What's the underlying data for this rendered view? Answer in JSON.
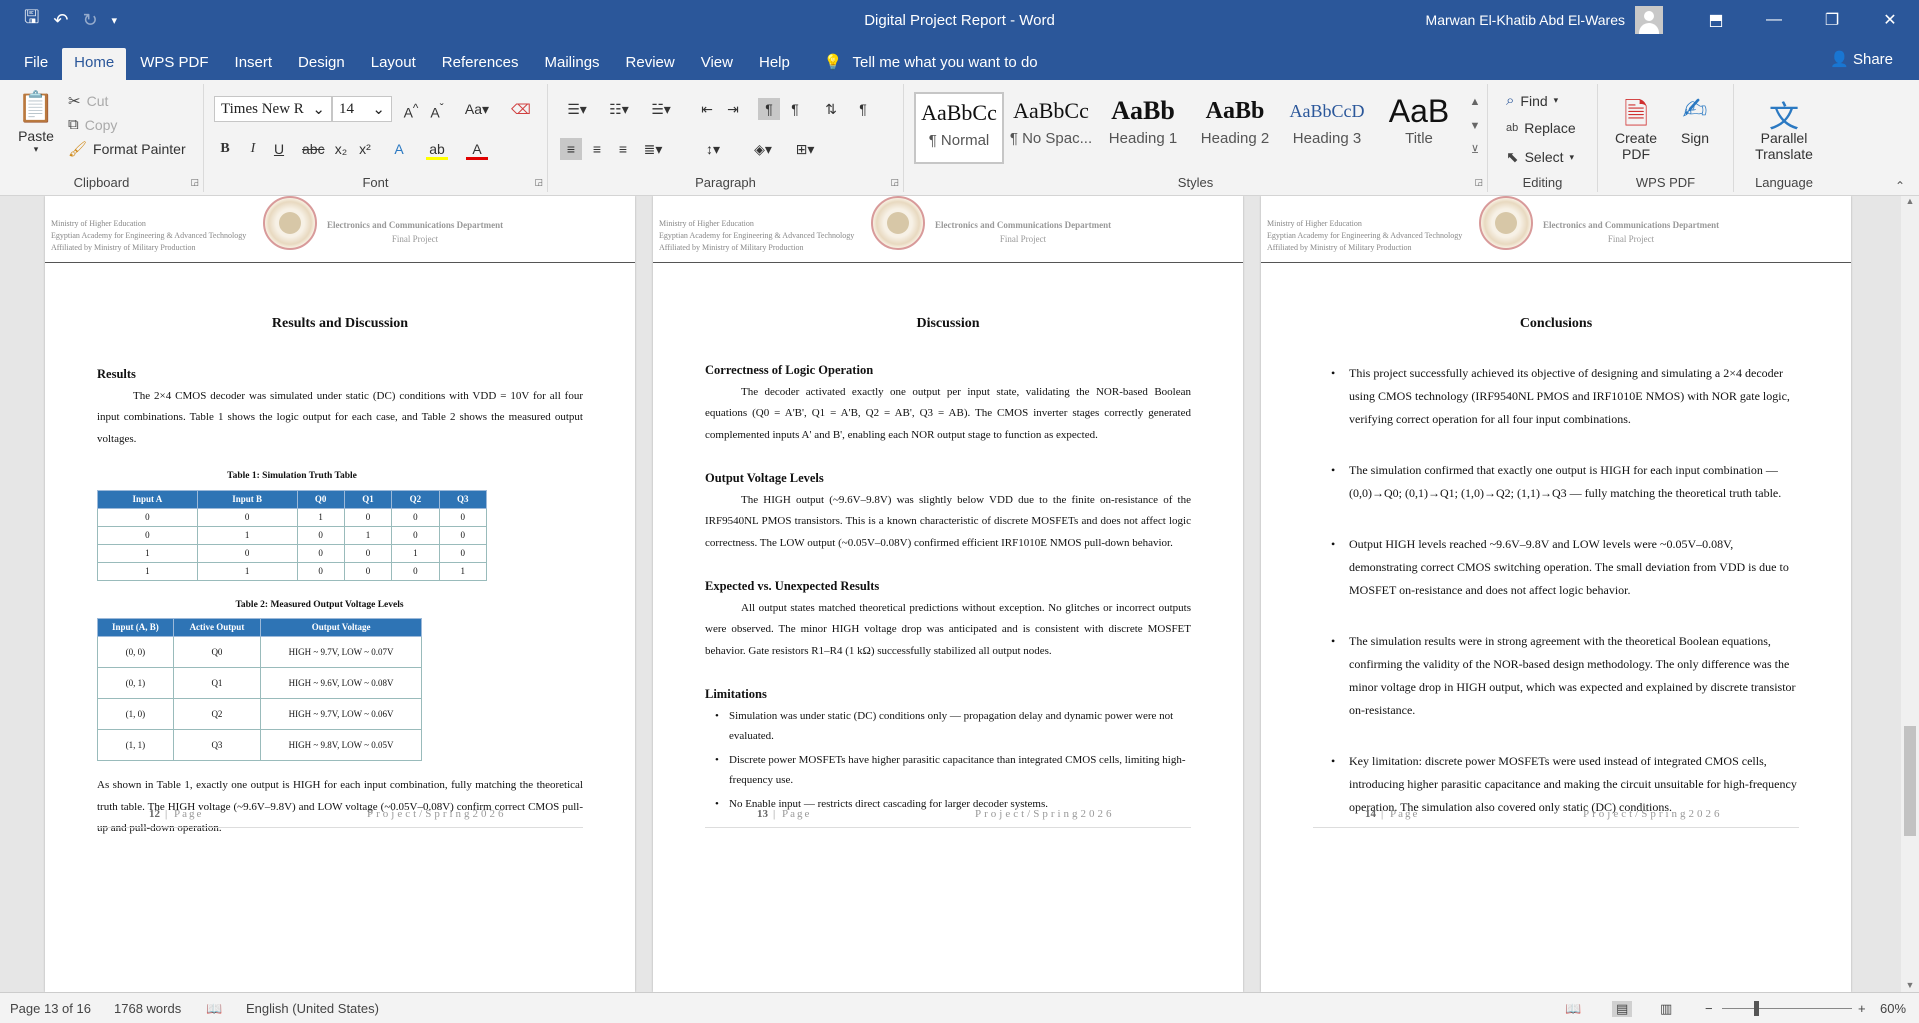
{
  "window": {
    "title": "Digital Project Report  -  Word",
    "user": "Marwan El-Khatib Abd El-Wares"
  },
  "menu": {
    "tabs": [
      "File",
      "Home",
      "WPS PDF",
      "Insert",
      "Design",
      "Layout",
      "References",
      "Mailings",
      "Review",
      "View",
      "Help"
    ],
    "tellme": "Tell me what you want to do",
    "share": "Share"
  },
  "ribbon": {
    "clipboard": {
      "label": "Clipboard",
      "paste": "Paste",
      "cut": "Cut",
      "copy": "Copy",
      "format_painter": "Format Painter"
    },
    "font": {
      "label": "Font",
      "name": "Times New R",
      "size": "14"
    },
    "paragraph": {
      "label": "Paragraph"
    },
    "styles": {
      "label": "Styles",
      "items": [
        {
          "preview": "AaBbCc",
          "name": "¶ Normal"
        },
        {
          "preview": "AaBbCc",
          "name": "¶ No Spac..."
        },
        {
          "preview": "AaBb",
          "name": "Heading 1"
        },
        {
          "preview": "AaBb",
          "name": "Heading 2"
        },
        {
          "preview": "AaBbCcD",
          "name": "Heading 3"
        },
        {
          "preview": "AaB",
          "name": "Title"
        }
      ]
    },
    "editing": {
      "label": "Editing",
      "find": "Find",
      "replace": "Replace",
      "select": "Select"
    },
    "wps": {
      "label": "WPS PDF",
      "create": "Create PDF",
      "sign": "Sign"
    },
    "language": {
      "label": "Language",
      "translate": "Parallel Translate"
    }
  },
  "header": {
    "left1": "Ministry of Higher Education",
    "left2": "Egyptian Academy for Engineering & Advanced Technology",
    "left3": "Affiliated by Ministry of Military Production",
    "dept": "Electronics and Communications Department",
    "final": "Final Project"
  },
  "footer": {
    "page_word": "| Page",
    "project": "Project/Spring2026"
  },
  "page12": {
    "number": "12",
    "title": "Results and Discussion",
    "results_heading": "Results",
    "results_text": "The 2×4 CMOS decoder was simulated under static (DC) conditions with VDD = 10V for all four input combinations. Table 1 shows the logic output for each case, and Table 2 shows the measured output voltages.",
    "table1": {
      "caption": "Table 1: Simulation Truth Table",
      "headers": [
        "Input A",
        "Input B",
        "Q0",
        "Q1",
        "Q2",
        "Q3"
      ],
      "rows": [
        [
          "0",
          "0",
          "1",
          "0",
          "0",
          "0"
        ],
        [
          "0",
          "1",
          "0",
          "1",
          "0",
          "0"
        ],
        [
          "1",
          "0",
          "0",
          "0",
          "1",
          "0"
        ],
        [
          "1",
          "1",
          "0",
          "0",
          "0",
          "1"
        ]
      ]
    },
    "table2": {
      "caption": "Table 2: Measured Output Voltage Levels",
      "headers": [
        "Input (A, B)",
        "Active Output",
        "Output Voltage"
      ],
      "rows": [
        [
          "(0, 0)",
          "Q0",
          "HIGH ~ 9.7V, LOW ~ 0.07V"
        ],
        [
          "(0, 1)",
          "Q1",
          "HIGH ~ 9.6V, LOW ~ 0.08V"
        ],
        [
          "(1, 0)",
          "Q2",
          "HIGH ~ 9.7V, LOW ~ 0.06V"
        ],
        [
          "(1, 1)",
          "Q3",
          "HIGH ~ 9.8V, LOW ~ 0.05V"
        ]
      ]
    },
    "conclusion_text": "As shown in Table 1, exactly one output is HIGH for each input combination, fully matching the theoretical truth table. The HIGH voltage (~9.6V–9.8V) and LOW voltage (~0.05V–0.08V) confirm correct CMOS pull-up and pull-down operation."
  },
  "page13": {
    "number": "13",
    "title": "Discussion",
    "s1_heading": "Correctness of Logic Operation",
    "s1_text": "The decoder activated exactly one output per input state, validating the NOR-based Boolean equations (Q0 = A'B', Q1 = A'B, Q2 = AB', Q3 = AB). The CMOS inverter stages correctly generated complemented inputs A' and B', enabling each NOR output stage to function as expected.",
    "s2_heading": "Output Voltage Levels",
    "s2_text": "The HIGH output (~9.6V–9.8V) was slightly below VDD due to the finite on-resistance of the IRF9540NL PMOS transistors. This is a known characteristic of discrete MOSFETs and does not affect logic correctness. The LOW output (~0.05V–0.08V) confirmed efficient IRF1010E NMOS pull-down behavior.",
    "s3_heading": "Expected vs. Unexpected Results",
    "s3_text": "All output states matched theoretical predictions without exception. No glitches or incorrect outputs were observed. The minor HIGH voltage drop was anticipated and is consistent with discrete MOSFET behavior. Gate resistors R1–R4 (1 kΩ) successfully stabilized all output nodes.",
    "s4_heading": "Limitations",
    "limitations": [
      "Simulation was under static (DC) conditions only — propagation delay and dynamic power were not evaluated.",
      "Discrete power MOSFETs have higher parasitic capacitance than integrated CMOS cells, limiting high-frequency use.",
      "No Enable input — restricts direct cascading for larger decoder systems."
    ]
  },
  "page14": {
    "number": "14",
    "title": "Conclusions",
    "bullets": [
      "This project successfully achieved its objective of designing and simulating a 2×4 decoder using CMOS technology (IRF9540NL PMOS and IRF1010E NMOS) with NOR gate logic, verifying correct operation for all four input combinations.",
      "The simulation confirmed that exactly one output is HIGH for each input combination — (0,0)→Q0; (0,1)→Q1; (1,0)→Q2; (1,1)→Q3 — fully matching the theoretical truth table.",
      "Output HIGH levels reached ~9.6V–9.8V and LOW levels were ~0.05V–0.08V, demonstrating correct CMOS switching operation. The small deviation from VDD is due to MOSFET on-resistance and does not affect logic behavior.",
      "The simulation results were in strong agreement with the theoretical Boolean equations, confirming the validity of the NOR-based design methodology. The only difference was the minor voltage drop in HIGH output, which was expected and explained by discrete transistor on-resistance.",
      "Key limitation: discrete power MOSFETs were used instead of integrated CMOS cells, introducing higher parasitic capacitance and making the circuit unsuitable for high-frequency operation. The simulation also covered only static (DC) conditions."
    ]
  },
  "status": {
    "page": "Page 13 of 16",
    "words": "1768 words",
    "language": "English (United States)",
    "zoom": "60%"
  }
}
